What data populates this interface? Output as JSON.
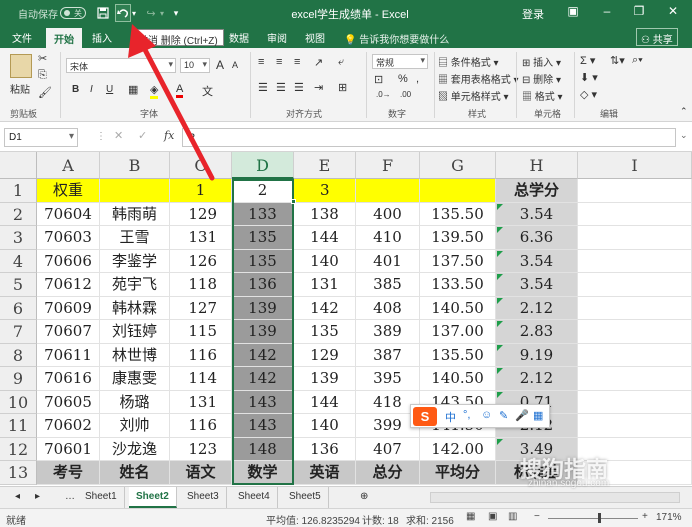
{
  "titlebar": {
    "autosave_label": "自动保存",
    "autosave_state": "关",
    "title": "excel学生成绩单  -  Excel",
    "signin": "登录"
  },
  "tabs": {
    "file": "文件",
    "home": "开始",
    "insert": "插入",
    "data": "数据",
    "review": "审阅",
    "view": "视图"
  },
  "tooltip": "撤消 删除 (Ctrl+Z)",
  "tell_me": "告诉我你想要做什么",
  "share": "共享",
  "ribbon": {
    "clipboard_label": "剪贴板",
    "paste": "粘贴",
    "font_label": "字体",
    "font_name": "宋体",
    "font_size": "10",
    "bold": "B",
    "italic": "I",
    "underline": "U",
    "font_large": "A",
    "font_small": "A",
    "align_label": "对齐方式",
    "number_label": "数字",
    "number_format": "常规",
    "styles_label": "样式",
    "cond_format": "条件格式",
    "table_format": "套用表格格式",
    "cell_styles": "单元格样式",
    "cells_label": "单元格",
    "insert": "插入",
    "delete": "删除",
    "format": "格式",
    "edit_label": "编辑"
  },
  "formula_bar": {
    "name_box": "D1",
    "fx": "fx",
    "value": "2"
  },
  "columns": [
    "A",
    "B",
    "C",
    "D",
    "E",
    "F",
    "G",
    "H",
    "I"
  ],
  "rows": [
    [
      "权重",
      "",
      "1",
      "2",
      "3",
      "",
      "",
      "总学分",
      ""
    ],
    [
      "70604",
      "韩雨萌",
      "129",
      "133",
      "138",
      "400",
      "135.50",
      "3.54",
      ""
    ],
    [
      "70603",
      "王雪",
      "131",
      "135",
      "144",
      "410",
      "139.50",
      "6.36",
      ""
    ],
    [
      "70606",
      "李鉴学",
      "126",
      "135",
      "140",
      "401",
      "137.50",
      "3.54",
      ""
    ],
    [
      "70612",
      "苑宇飞",
      "118",
      "136",
      "131",
      "385",
      "133.50",
      "3.54",
      ""
    ],
    [
      "70609",
      "韩林霖",
      "127",
      "139",
      "142",
      "408",
      "140.50",
      "2.12",
      ""
    ],
    [
      "70607",
      "刘钰婷",
      "115",
      "139",
      "135",
      "389",
      "137.00",
      "2.83",
      ""
    ],
    [
      "70611",
      "林世博",
      "116",
      "142",
      "129",
      "387",
      "135.50",
      "9.19",
      ""
    ],
    [
      "70616",
      "康惠雯",
      "114",
      "142",
      "139",
      "395",
      "140.50",
      "2.12",
      ""
    ],
    [
      "70605",
      "杨璐",
      "131",
      "143",
      "144",
      "418",
      "143.50",
      "0.71",
      ""
    ],
    [
      "70602",
      "刘帅",
      "116",
      "143",
      "140",
      "399",
      "141.50",
      "2.12",
      ""
    ],
    [
      "70601",
      "沙龙逸",
      "123",
      "148",
      "136",
      "407",
      "142.00",
      "3.49",
      ""
    ],
    [
      "考号",
      "姓名",
      "语文",
      "数学",
      "英语",
      "总分",
      "平均分",
      "标准差",
      ""
    ]
  ],
  "sheets": [
    "Sheet1",
    "Sheet2",
    "Sheet3",
    "Sheet4",
    "Sheet5"
  ],
  "active_sheet": "Sheet2",
  "status": {
    "mode": "就绪",
    "average": "平均值: 126.8235294",
    "count": "计数: 18",
    "sum": "求和: 2156",
    "zoom": "171%"
  },
  "ime": {
    "logo": "S",
    "lang": "中"
  },
  "watermark": {
    "text": "搜狗指南",
    "url": "zhinan.sogou.com"
  },
  "colors": {
    "excel_green": "#217346",
    "highlight_yellow": "#ffff00",
    "annotation_red": "#e8242b"
  }
}
